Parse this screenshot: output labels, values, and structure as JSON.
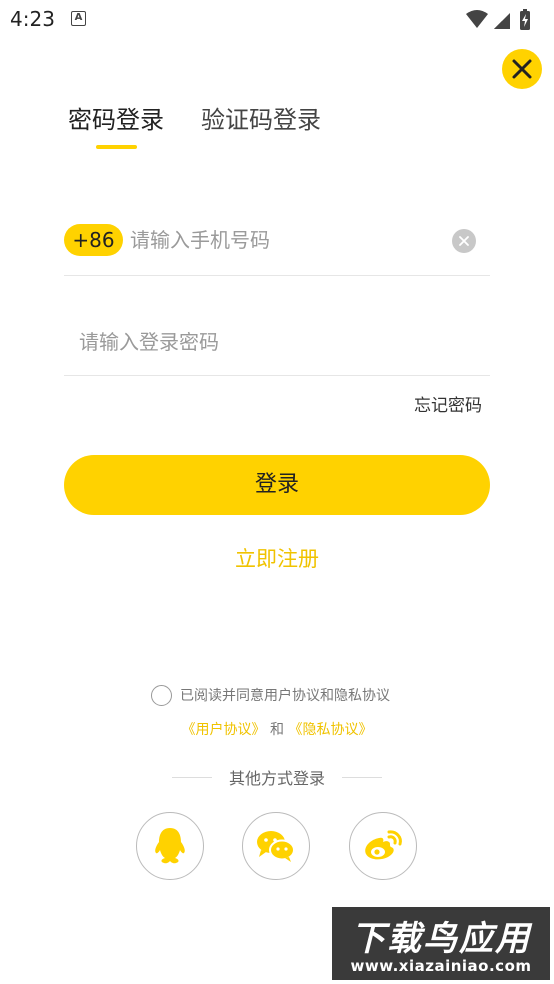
{
  "status_bar": {
    "time": "4:23",
    "notification_letter": "A",
    "icons": [
      "wifi-icon",
      "signal-icon",
      "battery-icon"
    ]
  },
  "tabs": [
    {
      "label": "密码登录",
      "active": true
    },
    {
      "label": "验证码登录",
      "active": false
    }
  ],
  "phone": {
    "country_code": "+86",
    "placeholder": "请输入手机号码",
    "value": ""
  },
  "password": {
    "placeholder": "请输入登录密码",
    "value": ""
  },
  "forgot_label": "忘记密码",
  "login_label": "登录",
  "register_label": "立即注册",
  "agreement": {
    "text": "已阅读并同意用户协议和隐私协议",
    "checked": false,
    "user_agreement": "《用户协议》",
    "and": "和",
    "privacy_agreement": "《隐私协议》"
  },
  "other_login": {
    "label": "其他方式登录",
    "providers": [
      "qq-icon",
      "wechat-icon",
      "weibo-icon"
    ]
  },
  "watermark": {
    "main": "下载鸟应用",
    "url": "www.xiazainiao.com"
  },
  "colors": {
    "accent": "#ffd200",
    "link": "#f0c300"
  }
}
